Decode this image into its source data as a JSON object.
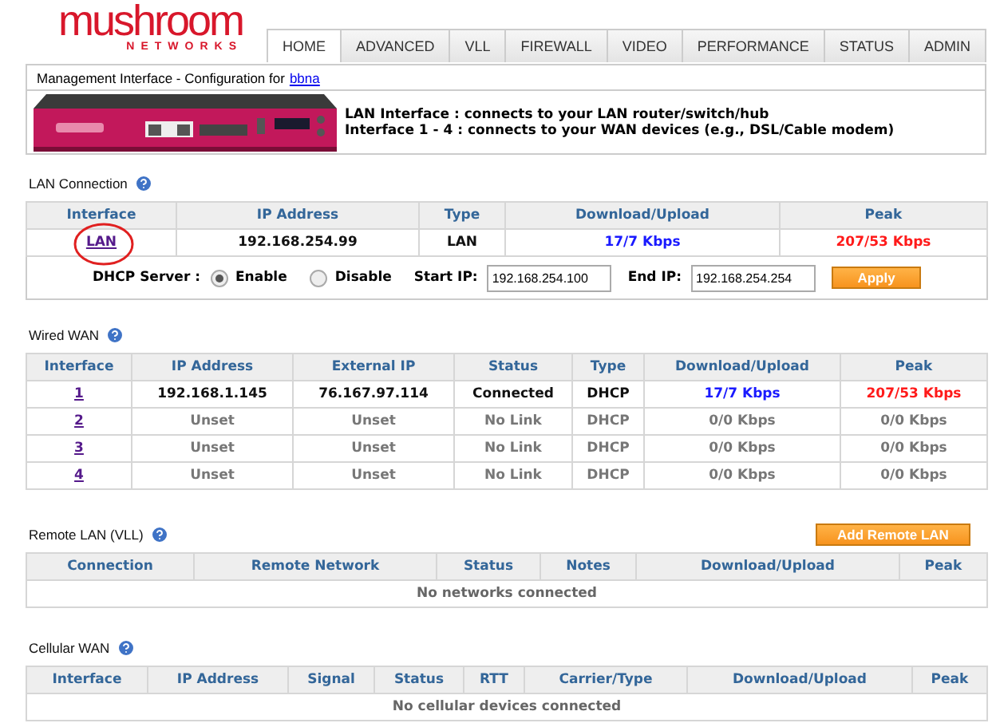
{
  "logo": {
    "name": "mushroom",
    "tagline": "NETWORKS"
  },
  "nav": [
    {
      "label": "HOME",
      "selected": true
    },
    {
      "label": "ADVANCED",
      "selected": false
    },
    {
      "label": "VLL",
      "selected": false
    },
    {
      "label": "FIREWALL",
      "selected": false
    },
    {
      "label": "VIDEO",
      "selected": false
    },
    {
      "label": "PERFORMANCE",
      "selected": false
    },
    {
      "label": "STATUS",
      "selected": false
    },
    {
      "label": "ADMIN",
      "selected": false
    }
  ],
  "management": {
    "text": "Management Interface - Configuration for",
    "link": "bbna"
  },
  "banner": {
    "kind": "picture",
    "lines": [
      "LAN Interface : connects to your LAN router/switch/hub",
      "Interface 1 - 4 : connects to your WAN devices (e.g., DSL/Cable modem)"
    ]
  },
  "lan_connection": {
    "title": "LAN Connection",
    "columns": [
      "Interface",
      "IP Address",
      "Type",
      "Download/Upload",
      "Peak"
    ],
    "rows": [
      {
        "interface": "LAN",
        "ip": "192.168.254.99",
        "type": "LAN",
        "rate": "17/7 Kbps",
        "peak": "207/53 Kbps",
        "highlighted": true
      }
    ],
    "dhcp": {
      "label": "DHCP Server :",
      "options": [
        {
          "label": "Enable",
          "selected": true
        },
        {
          "label": "Disable",
          "selected": false
        }
      ],
      "start_label": "Start IP:",
      "start_ip": "192.168.254.100",
      "end_label": "End IP:",
      "end_ip": "192.168.254.254",
      "button": "Apply"
    }
  },
  "wired_wan": {
    "title": "Wired WAN",
    "columns": [
      "Interface",
      "IP Address",
      "External IP",
      "Status",
      "Type",
      "Download/Upload",
      "Peak"
    ],
    "rows": [
      {
        "interface": "1",
        "ip": "192.168.1.145",
        "external_ip": "76.167.97.114",
        "status": "Connected",
        "type": "DHCP",
        "rate": "17/7 Kbps",
        "peak": "207/53 Kbps",
        "connected": true
      },
      {
        "interface": "2",
        "ip": "Unset",
        "external_ip": "Unset",
        "status": "No Link",
        "type": "DHCP",
        "rate": "0/0 Kbps",
        "peak": "0/0 Kbps",
        "connected": false
      },
      {
        "interface": "3",
        "ip": "Unset",
        "external_ip": "Unset",
        "status": "No Link",
        "type": "DHCP",
        "rate": "0/0 Kbps",
        "peak": "0/0 Kbps",
        "connected": false
      },
      {
        "interface": "4",
        "ip": "Unset",
        "external_ip": "Unset",
        "status": "No Link",
        "type": "DHCP",
        "rate": "0/0 Kbps",
        "peak": "0/0 Kbps",
        "connected": false
      }
    ]
  },
  "remote_lan": {
    "title": "Remote LAN (VLL)",
    "button": "Add Remote LAN",
    "columns": [
      "Connection",
      "Remote Network",
      "Status",
      "Notes",
      "Download/Upload",
      "Peak"
    ],
    "empty": "No networks connected"
  },
  "cellular_wan": {
    "title": "Cellular WAN",
    "columns": [
      "Interface",
      "IP Address",
      "Signal",
      "Status",
      "RTT",
      "Carrier/Type",
      "Download/Upload",
      "Peak"
    ],
    "empty": "No cellular devices connected"
  }
}
